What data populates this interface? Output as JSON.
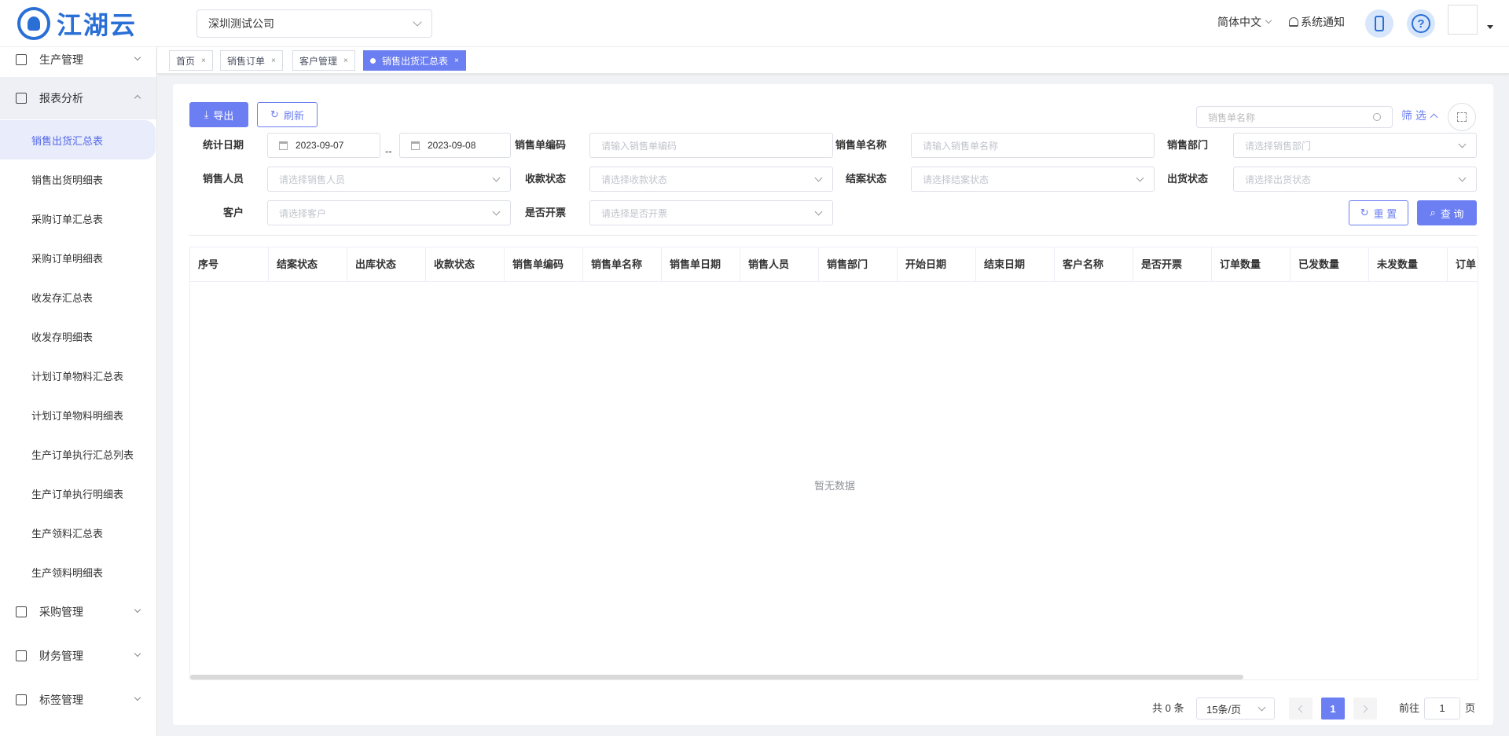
{
  "header": {
    "logo_text": "江湖云",
    "company": "深圳测试公司",
    "language": "简体中文",
    "notification": "系统通知",
    "help_symbol": "?"
  },
  "sidebar": {
    "top_items": [
      {
        "label": "生产管理",
        "icon": "edit-icon"
      },
      {
        "label": "报表分析",
        "icon": "table-icon"
      }
    ],
    "sub_items": [
      "销售出货汇总表",
      "销售出货明细表",
      "采购订单汇总表",
      "采购订单明细表",
      "收发存汇总表",
      "收发存明细表",
      "计划订单物料汇总表",
      "计划订单物料明细表",
      "生产订单执行汇总列表",
      "生产订单执行明细表",
      "生产领料汇总表",
      "生产领料明细表"
    ],
    "bottom_items": [
      {
        "label": "采购管理",
        "icon": "cart-icon"
      },
      {
        "label": "财务管理",
        "icon": "finance-icon"
      },
      {
        "label": "标签管理",
        "icon": "tag-icon"
      }
    ]
  },
  "tabs": [
    {
      "label": "首页"
    },
    {
      "label": "销售订单"
    },
    {
      "label": "客户管理"
    },
    {
      "label": "销售出货汇总表",
      "active": true
    }
  ],
  "toolbar": {
    "export_label": "导出",
    "refresh_label": "刷新",
    "search_placeholder": "销售单名称",
    "filter_label": "筛 选"
  },
  "filters": {
    "stat_date_label": "统计日期",
    "date_start": "2023-09-07",
    "date_sep": "--",
    "date_end": "2023-09-08",
    "order_code_label": "销售单编码",
    "order_code_placeholder": "请输入销售单编码",
    "order_name_label": "销售单名称",
    "order_name_placeholder": "请输入销售单名称",
    "dept_label": "销售部门",
    "dept_placeholder": "请选择销售部门",
    "salesman_label": "销售人员",
    "salesman_placeholder": "请选择销售人员",
    "payment_label": "收款状态",
    "payment_placeholder": "请选择收款状态",
    "close_label": "结案状态",
    "close_placeholder": "请选择结案状态",
    "ship_label": "出货状态",
    "ship_placeholder": "请选择出货状态",
    "customer_label": "客户",
    "customer_placeholder": "请选择客户",
    "invoice_label": "是否开票",
    "invoice_placeholder": "请选择是否开票",
    "reset_label": "重 置",
    "query_label": "查 询"
  },
  "table": {
    "columns": [
      "序号",
      "结案状态",
      "出库状态",
      "收款状态",
      "销售单编码",
      "销售单名称",
      "销售单日期",
      "销售人员",
      "销售部门",
      "开始日期",
      "结束日期",
      "客户名称",
      "是否开票",
      "订单数量",
      "已发数量",
      "未发数量",
      "订单"
    ],
    "empty_text": "暂无数据"
  },
  "pagination": {
    "total_text": "共 0 条",
    "page_size": "15条/页",
    "current_page": "1",
    "goto_label": "前往",
    "goto_value": "1",
    "page_unit": "页"
  }
}
